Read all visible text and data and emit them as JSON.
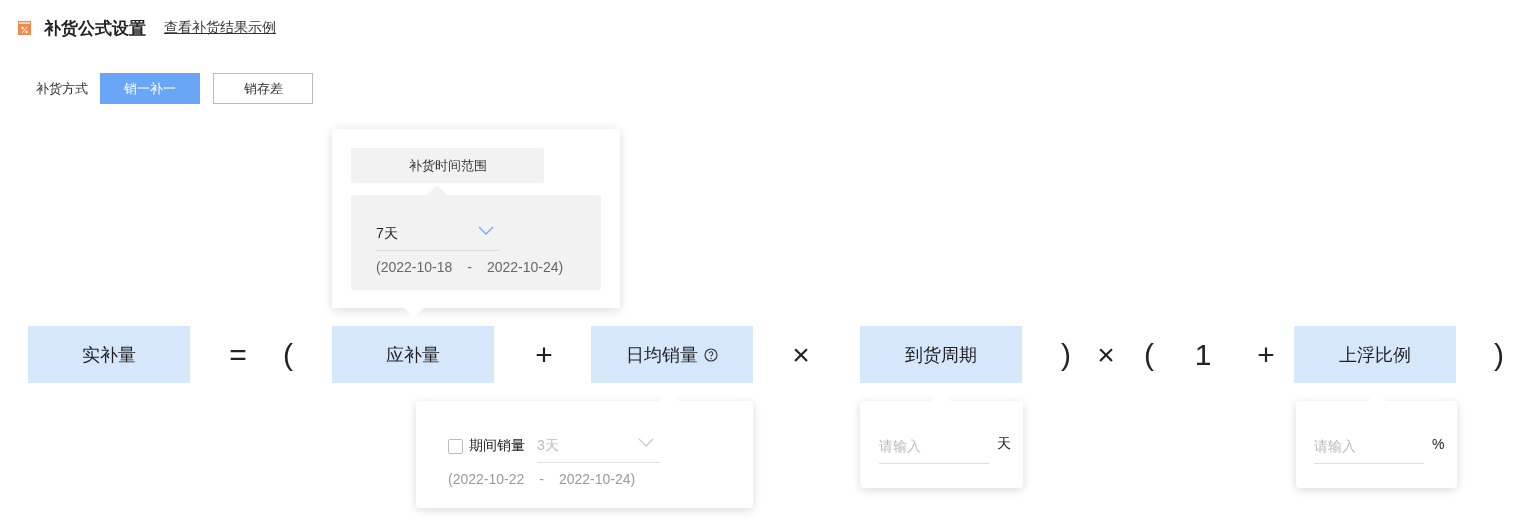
{
  "header": {
    "title": "补货公式设置",
    "link": "查看补货结果示例"
  },
  "method": {
    "label": "补货方式",
    "options": [
      {
        "label": "销一补一",
        "selected": true
      },
      {
        "label": "销存差",
        "selected": false
      }
    ]
  },
  "formula": [
    {
      "kind": "term",
      "label": "实补量"
    },
    {
      "kind": "operator",
      "label": "="
    },
    {
      "kind": "operator",
      "label": "("
    },
    {
      "kind": "term",
      "label": "应补量",
      "popover": {
        "kind": "range",
        "heading": "补货时间范围",
        "select": {
          "value": "7天",
          "disabled": false
        },
        "range_start": "(2022-10-18",
        "range_sep": "-",
        "range_end": "2022-10-24)"
      }
    },
    {
      "kind": "operator",
      "label": "+"
    },
    {
      "kind": "term",
      "label": "日均销量",
      "help": true,
      "popover": {
        "kind": "period",
        "checkbox": {
          "label": "期间销量",
          "checked": false
        },
        "select": {
          "value": "3天",
          "disabled": true
        },
        "range_start": "(2022-10-22",
        "range_sep": "-",
        "range_end": "2022-10-24)"
      }
    },
    {
      "kind": "operator",
      "label": "×"
    },
    {
      "kind": "term",
      "label": "到货周期",
      "popover": {
        "kind": "input",
        "placeholder": "请输入",
        "unit": "天"
      }
    },
    {
      "kind": "operator",
      "label": ")"
    },
    {
      "kind": "operator",
      "label": "×"
    },
    {
      "kind": "operator",
      "label": "("
    },
    {
      "kind": "operator",
      "label": "1"
    },
    {
      "kind": "operator",
      "label": "+"
    },
    {
      "kind": "term",
      "label": "上浮比例",
      "popover": {
        "kind": "input",
        "placeholder": "请输入",
        "unit": "%"
      }
    },
    {
      "kind": "operator",
      "label": ")"
    }
  ]
}
